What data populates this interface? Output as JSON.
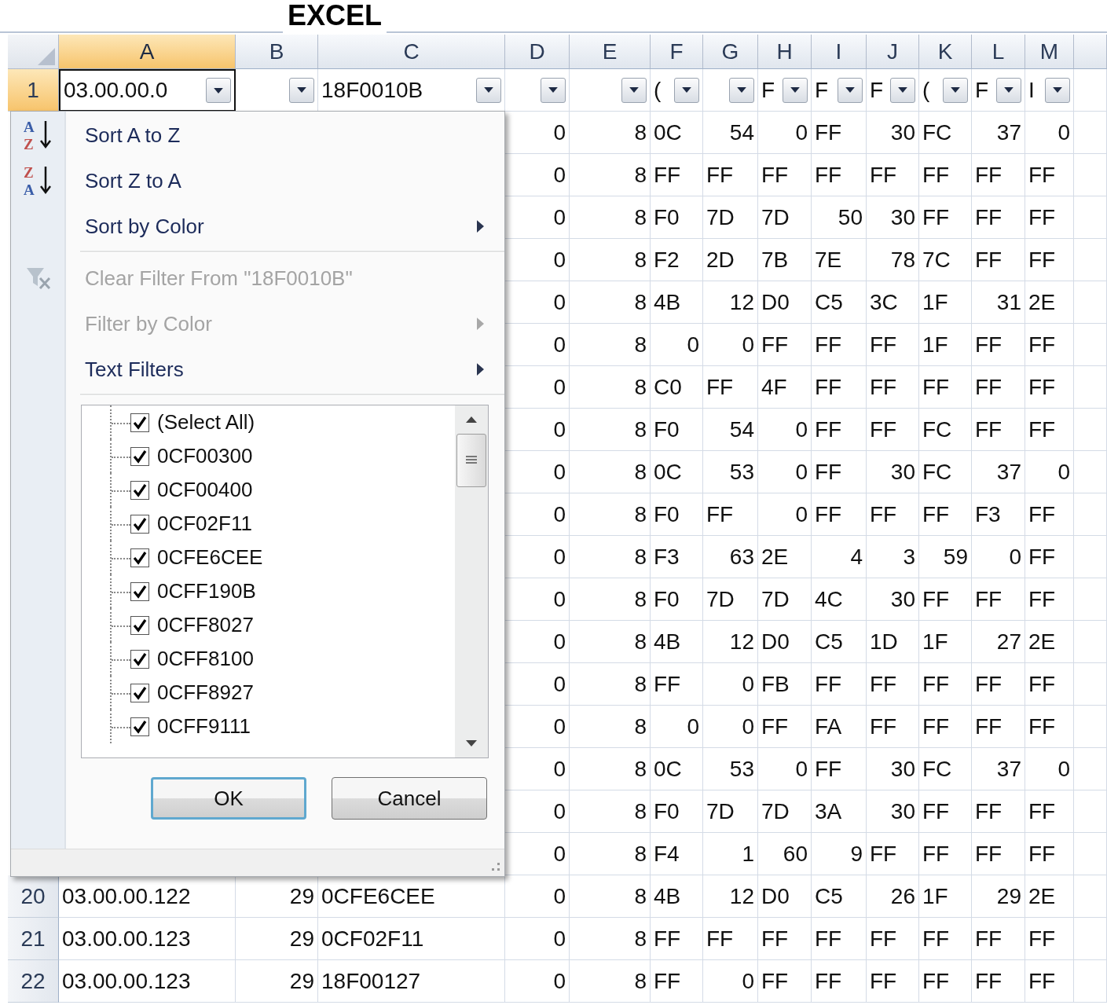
{
  "title": "EXCEL",
  "columns": [
    {
      "label": "A",
      "selected": true
    },
    {
      "label": "B",
      "selected": false
    },
    {
      "label": "C",
      "selected": false
    },
    {
      "label": "D",
      "selected": false
    },
    {
      "label": "E",
      "selected": false
    },
    {
      "label": "F",
      "selected": false
    },
    {
      "label": "G",
      "selected": false
    },
    {
      "label": "H",
      "selected": false
    },
    {
      "label": "I",
      "selected": false
    },
    {
      "label": "J",
      "selected": false
    },
    {
      "label": "K",
      "selected": false
    },
    {
      "label": "L",
      "selected": false
    },
    {
      "label": "M",
      "selected": false
    }
  ],
  "filter_row": {
    "number": "1",
    "selected": true,
    "cells": [
      {
        "text": "03.00.00.0",
        "active": true
      },
      {
        "active": false
      },
      {
        "text": "18F0010B",
        "active": false
      },
      {
        "active": false
      },
      {
        "active": false
      },
      {
        "text": "(",
        "active": false
      },
      {
        "active": false
      },
      {
        "text": "F",
        "active": false
      },
      {
        "text": "F",
        "active": false
      },
      {
        "text": "F",
        "active": false
      },
      {
        "text": "(",
        "active": false
      },
      {
        "text": "F",
        "active": false
      },
      {
        "text": "I",
        "active": false
      }
    ]
  },
  "rows": [
    {
      "cells": [
        "0",
        "8",
        "0C",
        "54",
        "0",
        "FF",
        "30",
        "FC",
        "37",
        "0"
      ]
    },
    {
      "cells": [
        "0",
        "8",
        "FF",
        "FF",
        "FF",
        "FF",
        "FF",
        "FF",
        "FF",
        "FF"
      ]
    },
    {
      "cells": [
        "0",
        "8",
        "F0",
        "7D",
        "7D",
        "50",
        "30",
        "FF",
        "FF",
        "FF"
      ]
    },
    {
      "cells": [
        "0",
        "8",
        "F2",
        "2D",
        "7B",
        "7E",
        "78",
        "7C",
        "FF",
        "FF"
      ]
    },
    {
      "cells": [
        "0",
        "8",
        "4B",
        "12",
        "D0",
        "C5",
        "3C",
        "1F",
        "31",
        "2E"
      ]
    },
    {
      "cells": [
        "0",
        "8",
        "0",
        "0",
        "FF",
        "FF",
        "FF",
        "1F",
        "FF",
        "FF"
      ]
    },
    {
      "cells": [
        "0",
        "8",
        "C0",
        "FF",
        "4F",
        "FF",
        "FF",
        "FF",
        "FF",
        "FF"
      ]
    },
    {
      "cells": [
        "0",
        "8",
        "F0",
        "54",
        "0",
        "FF",
        "FF",
        "FC",
        "FF",
        "FF"
      ]
    },
    {
      "cells": [
        "0",
        "8",
        "0C",
        "53",
        "0",
        "FF",
        "30",
        "FC",
        "37",
        "0"
      ]
    },
    {
      "cells": [
        "0",
        "8",
        "F0",
        "FF",
        "0",
        "FF",
        "FF",
        "FF",
        "F3",
        "FF"
      ]
    },
    {
      "cells": [
        "0",
        "8",
        "F3",
        "63",
        "2E",
        "4",
        "3",
        "59",
        "0",
        "FF"
      ]
    },
    {
      "cells": [
        "0",
        "8",
        "F0",
        "7D",
        "7D",
        "4C",
        "30",
        "FF",
        "FF",
        "FF"
      ]
    },
    {
      "cells": [
        "0",
        "8",
        "4B",
        "12",
        "D0",
        "C5",
        "1D",
        "1F",
        "27",
        "2E"
      ]
    },
    {
      "cells": [
        "0",
        "8",
        "FF",
        "0",
        "FB",
        "FF",
        "FF",
        "FF",
        "FF",
        "FF"
      ]
    },
    {
      "cells": [
        "0",
        "8",
        "0",
        "0",
        "FF",
        "FA",
        "FF",
        "FF",
        "FF",
        "FF"
      ]
    },
    {
      "cells": [
        "0",
        "8",
        "0C",
        "53",
        "0",
        "FF",
        "30",
        "FC",
        "37",
        "0"
      ]
    },
    {
      "cells": [
        "0",
        "8",
        "F0",
        "7D",
        "7D",
        "3A",
        "30",
        "FF",
        "FF",
        "FF"
      ]
    },
    {
      "cells": [
        "0",
        "8",
        "F4",
        "1",
        "60",
        "9",
        "FF",
        "FF",
        "FF",
        "FF"
      ]
    },
    {
      "number": "20",
      "cells": [
        "03.00.00.122",
        "29",
        "0CFE6CEE",
        "0",
        "8",
        "4B",
        "12",
        "D0",
        "C5",
        "26",
        "1F",
        "29",
        "2E"
      ]
    },
    {
      "number": "21",
      "cells": [
        "03.00.00.123",
        "29",
        "0CF02F11",
        "0",
        "8",
        "FF",
        "FF",
        "FF",
        "FF",
        "FF",
        "FF",
        "FF",
        "FF"
      ]
    },
    {
      "number": "22",
      "cells": [
        "03.00.00.123",
        "29",
        "18F00127",
        "0",
        "8",
        "FF",
        "0",
        "FF",
        "FF",
        "FF",
        "FF",
        "FF",
        "FF"
      ]
    }
  ],
  "filter_menu": {
    "items": [
      {
        "kind": "sort",
        "label": "Sort A to Z",
        "icon_letters": [
          "A",
          "Z"
        ],
        "disabled": false,
        "submenu": false
      },
      {
        "kind": "sort",
        "label": "Sort Z to A",
        "icon_letters": [
          "Z",
          "A"
        ],
        "disabled": false,
        "submenu": false
      },
      {
        "kind": "plain",
        "label": "Sort by Color",
        "disabled": false,
        "submenu": true
      },
      {
        "kind": "separator"
      },
      {
        "kind": "clear",
        "label": "Clear Filter From \"18F0010B\"",
        "disabled": true,
        "submenu": false
      },
      {
        "kind": "plain",
        "label": "Filter by Color",
        "disabled": true,
        "submenu": true
      },
      {
        "kind": "plain",
        "label": "Text Filters",
        "disabled": false,
        "submenu": true
      },
      {
        "kind": "separator"
      }
    ],
    "values": [
      {
        "label": "(Select All)",
        "checked": true
      },
      {
        "label": "0CF00300",
        "checked": true
      },
      {
        "label": "0CF00400",
        "checked": true
      },
      {
        "label": "0CF02F11",
        "checked": true
      },
      {
        "label": "0CFE6CEE",
        "checked": true
      },
      {
        "label": "0CFF190B",
        "checked": true
      },
      {
        "label": "0CFF8027",
        "checked": true
      },
      {
        "label": "0CFF8100",
        "checked": true
      },
      {
        "label": "0CFF8927",
        "checked": true
      },
      {
        "label": "0CFF9111",
        "checked": true
      }
    ],
    "buttons": [
      {
        "label": "OK",
        "focused": true
      },
      {
        "label": "Cancel",
        "focused": false
      }
    ]
  }
}
